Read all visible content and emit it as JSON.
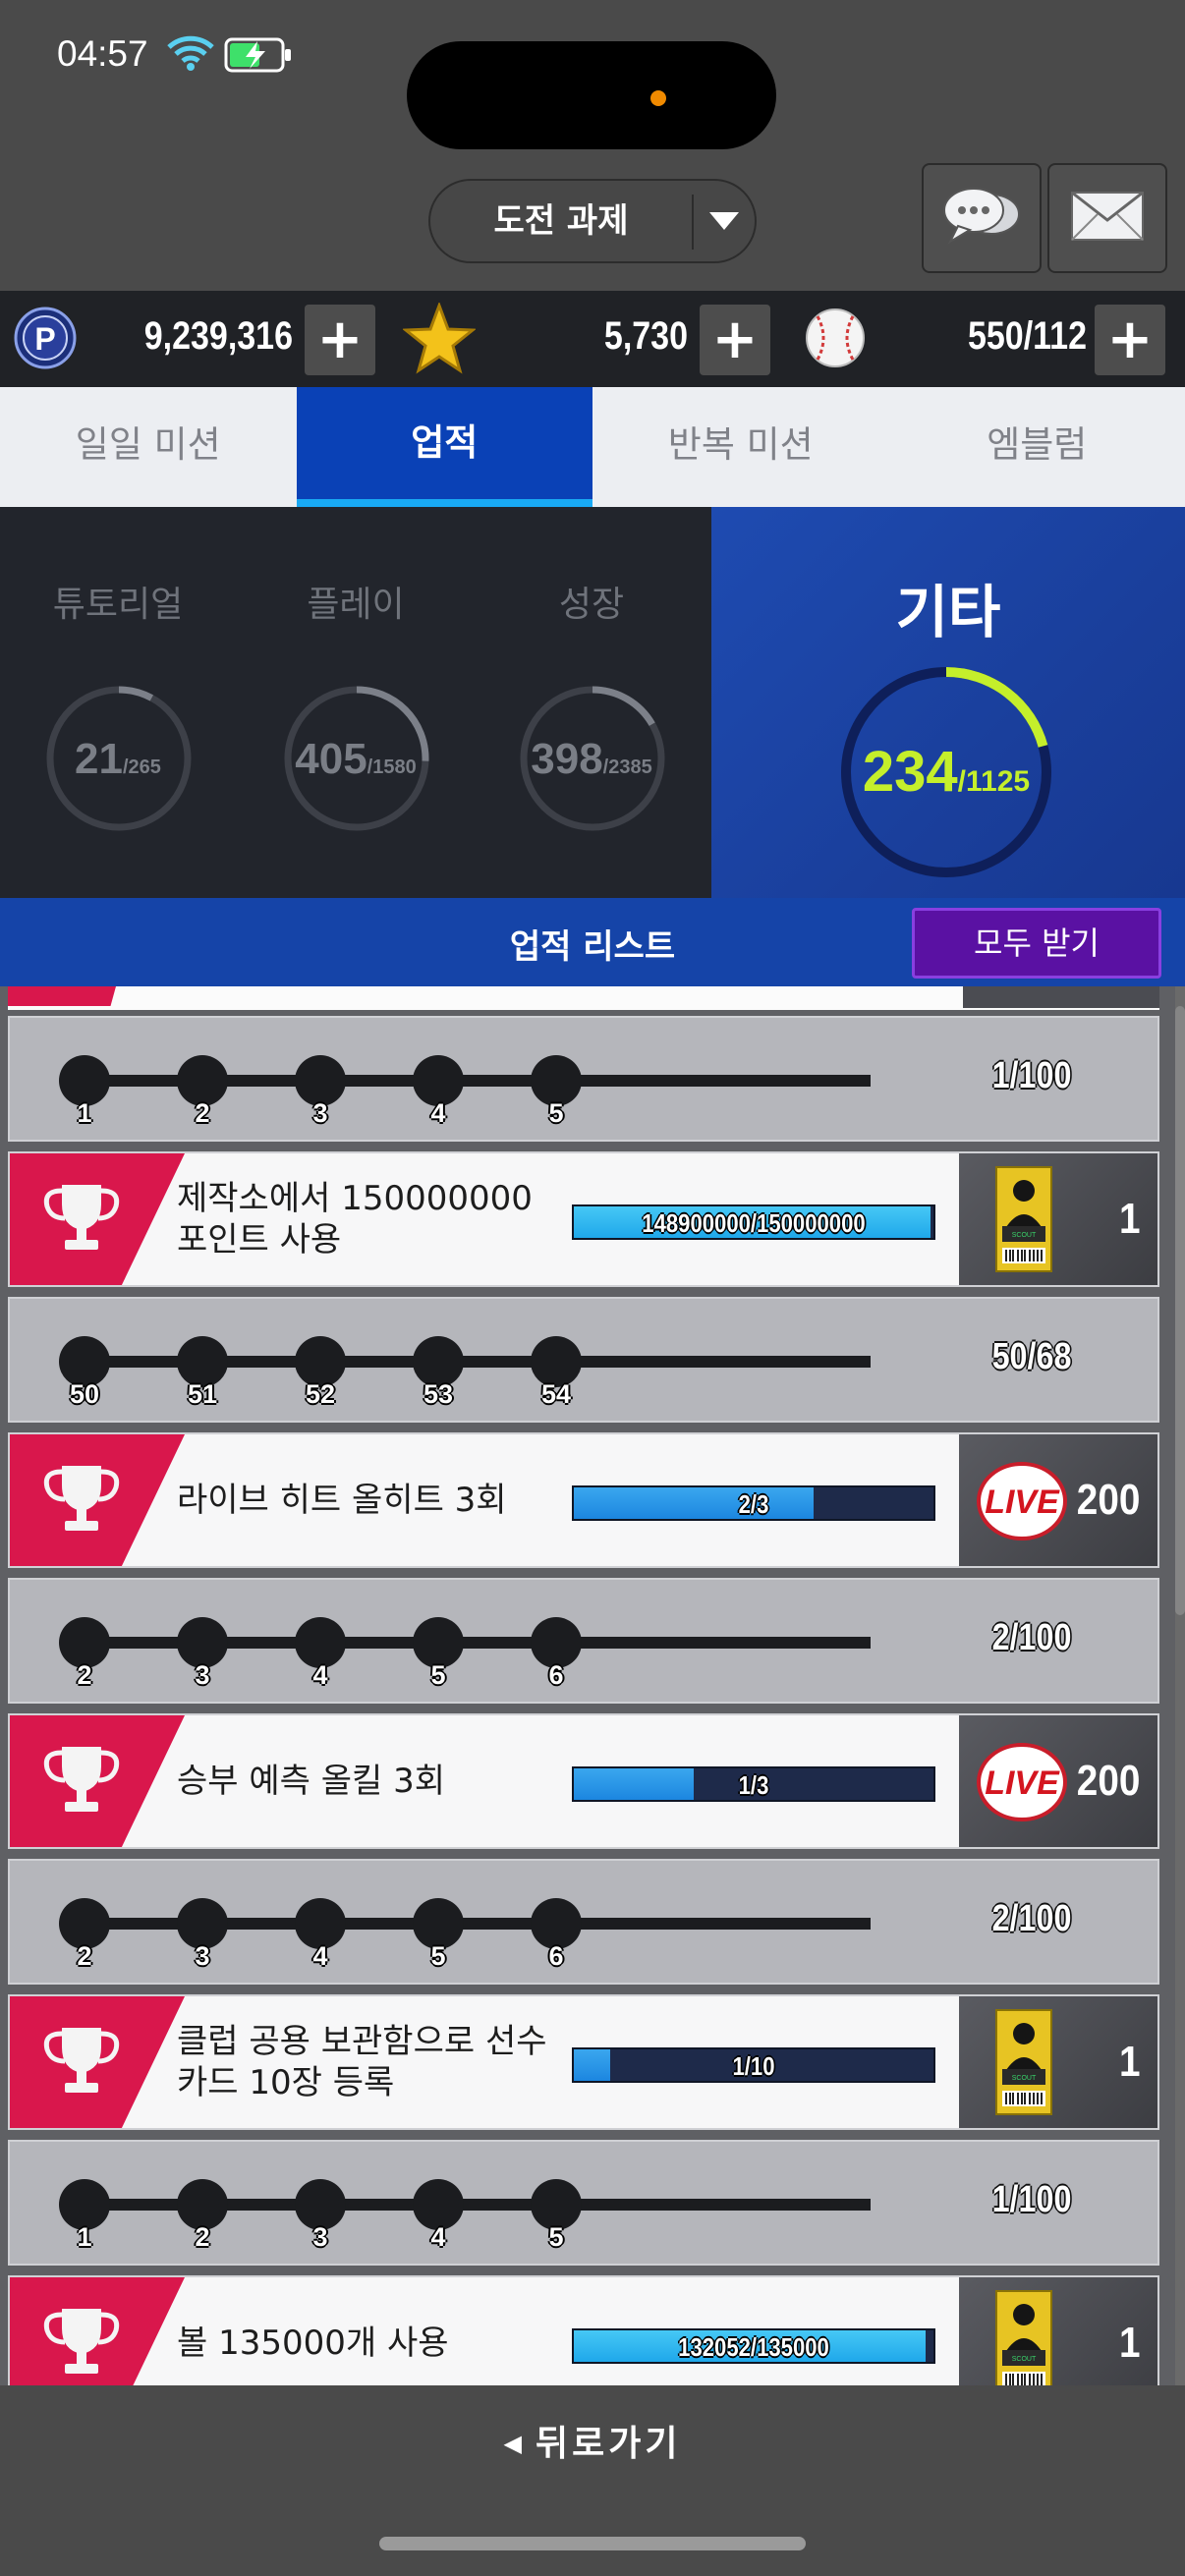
{
  "status_bar": {
    "time": "04:57"
  },
  "header": {
    "dropdown_label": "도전 과제"
  },
  "currency": {
    "points": "9,239,316",
    "stars": "5,730",
    "balls": "550/112"
  },
  "tabs": [
    {
      "label": "일일 미션",
      "active": false
    },
    {
      "label": "업적",
      "active": true
    },
    {
      "label": "반복 미션",
      "active": false
    },
    {
      "label": "엠블럼",
      "active": false
    }
  ],
  "stats": [
    {
      "name": "튜토리얼",
      "value": "21",
      "total": "/265",
      "progress": 0.079
    },
    {
      "name": "플레이",
      "value": "405",
      "total": "/1580",
      "progress": 0.256
    },
    {
      "name": "성장",
      "value": "398",
      "total": "/2385",
      "progress": 0.167
    }
  ],
  "other_stat": {
    "name": "기타",
    "value": "234",
    "total": "/1125",
    "progress": 0.208
  },
  "list_header": {
    "title": "업적 리스트",
    "claim_all": "모두 받기"
  },
  "progress_rows": [
    {
      "nodes": [
        "1",
        "2",
        "3",
        "4",
        "5"
      ],
      "count": "1/100"
    },
    {
      "nodes": [
        "50",
        "51",
        "52",
        "53",
        "54"
      ],
      "count": "50/68"
    },
    {
      "nodes": [
        "2",
        "3",
        "4",
        "5",
        "6"
      ],
      "count": "2/100"
    },
    {
      "nodes": [
        "2",
        "3",
        "4",
        "5",
        "6"
      ],
      "count": "2/100"
    },
    {
      "nodes": [
        "1",
        "2",
        "3",
        "4",
        "5"
      ],
      "count": "1/100"
    }
  ],
  "items": [
    {
      "text": "제작소에서 150000000 포인트 사용",
      "bar_text": "148900000/150000000",
      "progress": 0.993,
      "reward_type": "ticket",
      "reward_amount": "1"
    },
    {
      "text": "라이브 히트 올히트 3회",
      "bar_text": "2/3",
      "progress": 0.667,
      "reward_type": "live",
      "reward_amount": "200"
    },
    {
      "text": "승부 예측 올킬 3회",
      "bar_text": "1/3",
      "progress": 0.333,
      "reward_type": "live",
      "reward_amount": "200"
    },
    {
      "text": "클럽 공용 보관함으로 선수 카드 10장 등록",
      "bar_text": "1/10",
      "progress": 0.1,
      "reward_type": "ticket",
      "reward_amount": "1"
    },
    {
      "text": "볼 135000개 사용",
      "bar_text": "132052/135000",
      "progress": 0.978,
      "reward_type": "ticket",
      "reward_amount": "1"
    }
  ],
  "footer": {
    "back_label": "뒤로가기"
  }
}
